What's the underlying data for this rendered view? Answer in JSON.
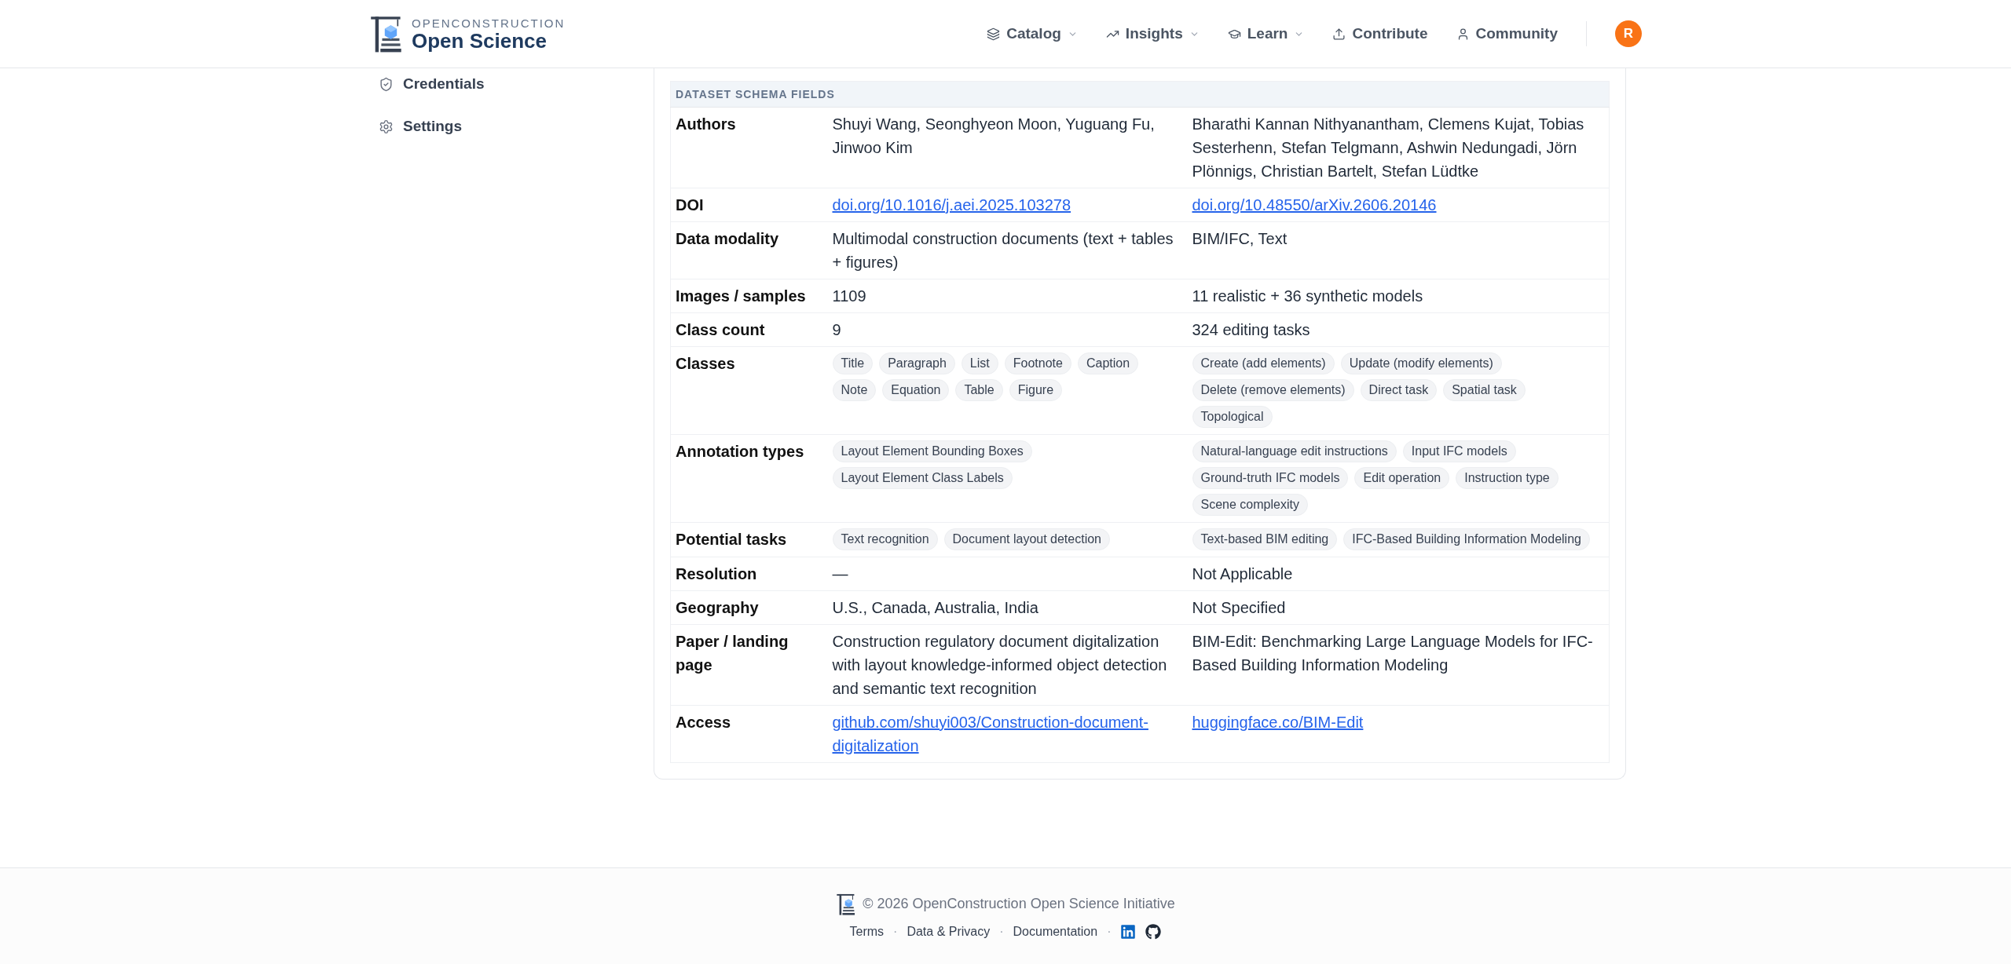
{
  "header": {
    "logo": {
      "tagline": "OPENCONSTRUCTION",
      "name": "Open Science"
    },
    "nav": [
      {
        "label": "Catalog",
        "kind": "catalog",
        "dropdown": true
      },
      {
        "label": "Insights",
        "kind": "insights",
        "dropdown": true
      },
      {
        "label": "Learn",
        "kind": "learn",
        "dropdown": true
      },
      {
        "label": "Contribute",
        "kind": "contribute",
        "dropdown": false
      },
      {
        "label": "Community",
        "kind": "community",
        "dropdown": false
      }
    ],
    "avatar": "R"
  },
  "sidebar": {
    "items": [
      {
        "label": "Credentials",
        "kind": "credentials"
      },
      {
        "label": "Settings",
        "kind": "settings"
      }
    ]
  },
  "table": {
    "section": "DATASET SCHEMA FIELDS",
    "rows": [
      {
        "field": "Authors",
        "kind": "text",
        "values": [
          "Shuyi Wang, Seonghyeon Moon, Yuguang Fu, Jinwoo Kim",
          "Bharathi Kannan Nithyanantham, Clemens Kujat, Tobias Sesterhenn, Stefan Telgmann, Ashwin Nedungadi, Jörn Plönnigs, Christian Bartelt, Stefan Lüdtke"
        ]
      },
      {
        "field": "DOI",
        "kind": "link",
        "values": [
          "doi.org/10.1016/j.aei.2025.103278",
          "doi.org/10.48550/arXiv.2606.20146"
        ]
      },
      {
        "field": "Data modality",
        "kind": "text",
        "values": [
          "Multimodal construction documents (text + tables + figures)",
          "BIM/IFC, Text"
        ]
      },
      {
        "field": "Images / samples",
        "kind": "text",
        "values": [
          "1109",
          "11 realistic + 36 synthetic models"
        ]
      },
      {
        "field": "Class count",
        "kind": "text",
        "values": [
          "9",
          "324 editing tasks"
        ]
      },
      {
        "field": "Classes",
        "kind": "chips",
        "values": [
          [
            "Title",
            "Paragraph",
            "List",
            "Footnote",
            "Caption",
            "Note",
            "Equation",
            "Table",
            "Figure"
          ],
          [
            "Create (add elements)",
            "Update (modify elements)",
            "Delete (remove elements)",
            "Direct task",
            "Spatial task",
            "Topological"
          ]
        ]
      },
      {
        "field": "Annotation types",
        "kind": "chips",
        "values": [
          [
            "Layout Element Bounding Boxes",
            "Layout Element Class Labels"
          ],
          [
            "Natural-language edit instructions",
            "Input IFC models",
            "Ground-truth IFC models",
            "Edit operation",
            "Instruction type",
            "Scene complexity"
          ]
        ]
      },
      {
        "field": "Potential tasks",
        "kind": "chips",
        "values": [
          [
            "Text recognition",
            "Document layout detection"
          ],
          [
            "Text-based BIM editing",
            "IFC-Based Building Information Modeling"
          ]
        ]
      },
      {
        "field": "Resolution",
        "kind": "text",
        "values": [
          "—",
          "Not Applicable"
        ]
      },
      {
        "field": "Geography",
        "kind": "text",
        "values": [
          "U.S., Canada, Australia, India",
          "Not Specified"
        ]
      },
      {
        "field": "Paper / landing page",
        "kind": "text",
        "values": [
          "Construction regulatory document digitalization with layout knowledge-informed object detection and semantic text recognition",
          "BIM-Edit: Benchmarking Large Language Models for IFC-Based Building Information Modeling"
        ]
      },
      {
        "field": "Access",
        "kind": "link",
        "values": [
          "github.com/shuyi003/Construction-document-digitalization",
          "huggingface.co/BIM-Edit"
        ]
      }
    ]
  },
  "footer": {
    "copyright": "© 2026 OpenConstruction Open Science Initiative",
    "links": [
      "Terms",
      "Data & Privacy",
      "Documentation"
    ],
    "separator": "·"
  }
}
